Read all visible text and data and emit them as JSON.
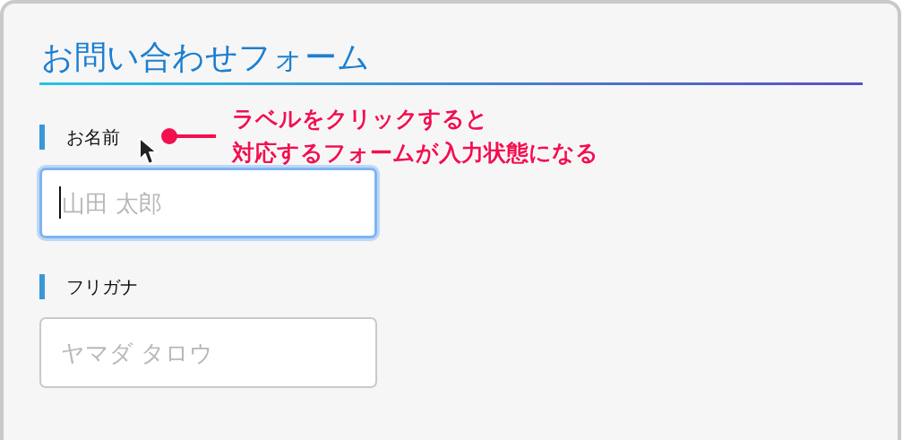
{
  "form": {
    "title": "お問い合わせフォーム",
    "fields": [
      {
        "label": "お名前",
        "placeholder": "山田 太郎",
        "focused": true
      },
      {
        "label": "フリガナ",
        "placeholder": "ヤマダ タロウ",
        "focused": false
      }
    ]
  },
  "annotation": {
    "lines": [
      "ラベルをクリックすると",
      "対応するフォームが入力状態になる"
    ]
  }
}
